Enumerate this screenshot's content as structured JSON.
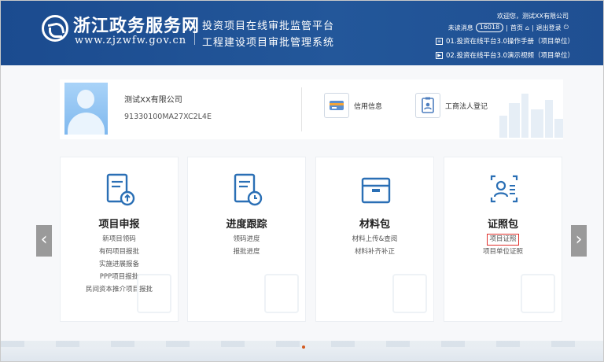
{
  "header": {
    "site_name": "浙江政务服务网",
    "site_url": "www.zjzwfw.gov.cn",
    "system_line1": "投资项目在线审批监管平台",
    "system_line2": "工程建设项目审批管理系统",
    "welcome": "欢迎您，测试XX有限公司",
    "unread_label": "未读消息",
    "unread_count": "16018",
    "home_label": "首页",
    "logout_label": "退出登录",
    "links": [
      {
        "label": "01.投资在线平台3.0操作手册（项目单位）"
      },
      {
        "label": "02.投资在线平台3.0演示视频（项目单位）"
      }
    ]
  },
  "profile": {
    "company": "测试XX有限公司",
    "code": "91330100MA27XC2L4E",
    "buttons": [
      {
        "label": "信用信息",
        "icon": "credit-card-icon"
      },
      {
        "label": "工商法人登记",
        "icon": "document-person-icon"
      }
    ]
  },
  "cards": [
    {
      "title": "项目申报",
      "icon": "form-upload-icon",
      "items": [
        "新项目领码",
        "有码项目报批",
        "实施进展报备",
        "PPP项目报批",
        "民间资本推介项目报批"
      ]
    },
    {
      "title": "进度跟踪",
      "icon": "document-clock-icon",
      "items": [
        "领码进度",
        "报批进度"
      ]
    },
    {
      "title": "材料包",
      "icon": "box-icon",
      "items": [
        "材料上传&查阅",
        "材料补齐补正"
      ]
    },
    {
      "title": "证照包",
      "icon": "id-card-icon",
      "items": [
        "项目证照",
        "项目单位证照"
      ],
      "highlighted_item": "项目证照"
    }
  ],
  "arrows": {
    "left": "‹",
    "right": "›"
  },
  "colors": {
    "header": "#1f4f92",
    "accent": "#2a6fb5",
    "highlight": "#e0302b"
  }
}
